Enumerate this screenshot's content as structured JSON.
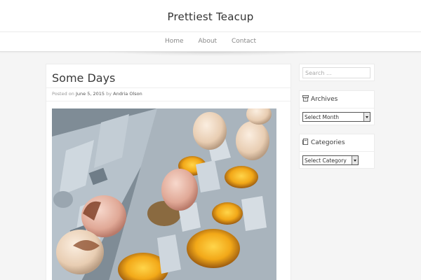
{
  "site": {
    "title": "Prettiest Teacup"
  },
  "nav": {
    "items": [
      "Home",
      "About",
      "Contact"
    ]
  },
  "post": {
    "title": "Some Days",
    "meta": {
      "posted_on": "Posted on",
      "date": "June 5, 2015",
      "by": "by",
      "author": "Andria Olson"
    },
    "image_alt": "egg carton with eggs and cracked shells"
  },
  "sidebar": {
    "search": {
      "placeholder": "Search ..."
    },
    "archives": {
      "title": "Archives",
      "select_value": "Select Month",
      "icon": "archive-icon"
    },
    "categories": {
      "title": "Categories",
      "select_value": "Select Category",
      "icon": "folder-icon"
    }
  },
  "colors": {
    "background": "#f5f5f5",
    "header": "#ffffff",
    "text": "#3a3a3a"
  }
}
